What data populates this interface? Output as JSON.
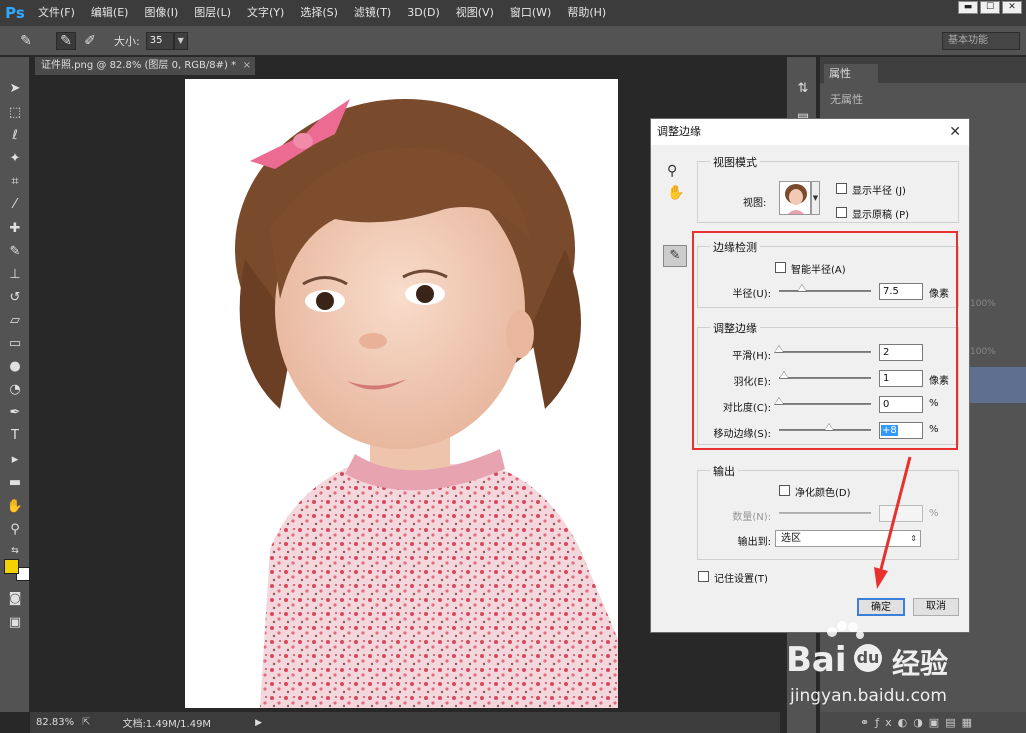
{
  "app": {
    "logo": "Ps",
    "menu": [
      "文件(F)",
      "编辑(E)",
      "图像(I)",
      "图层(L)",
      "文字(Y)",
      "选择(S)",
      "滤镜(T)",
      "3D(D)",
      "视图(V)",
      "窗口(W)",
      "帮助(H)"
    ],
    "window_controls": [
      "▬",
      "☐",
      "✕"
    ]
  },
  "options": {
    "size_label": "大小:",
    "size_value": "35",
    "workspace": "基本功能"
  },
  "document": {
    "tab_title": "证件照.png @ 82.8% (图层 0, RGB/8#) *",
    "tab_close": "×"
  },
  "statusbar": {
    "zoom": "82.83%",
    "doc_info": "文档:1.49M/1.49M"
  },
  "properties_panel": {
    "tab": "属性",
    "empty_text": "无属性"
  },
  "layers_panel": {
    "opacity_value": "100%",
    "fill_value": "100%"
  },
  "dialog": {
    "title": "调整边缘",
    "close": "✕",
    "view_mode": {
      "title": "视图模式",
      "view_label": "视图:",
      "show_radius": "显示半径 (J)",
      "show_original": "显示原稿 (P)"
    },
    "edge_detection": {
      "title": "边缘检测",
      "smart_radius": "智能半径(A)",
      "radius_label": "半径(U):",
      "radius_value": "7.5",
      "radius_unit": "像素",
      "radius_frac": 0.25
    },
    "adjust_edge": {
      "title": "调整边缘",
      "rows": [
        {
          "label": "平滑(H):",
          "value": "2",
          "unit": "",
          "frac": 0.0
        },
        {
          "label": "羽化(E):",
          "value": "1",
          "unit": "像素",
          "frac": 0.05
        },
        {
          "label": "对比度(C):",
          "value": "0",
          "unit": "%",
          "frac": 0.0
        },
        {
          "label": "移动边缘(S):",
          "value": "+8",
          "unit": "%",
          "frac": 0.54
        }
      ]
    },
    "output": {
      "title": "输出",
      "decontaminate": "净化颜色(D)",
      "amount_label": "数量(N):",
      "amount_unit": "%",
      "output_to_label": "输出到:",
      "output_to_value": "选区"
    },
    "remember": "记住设置(T)",
    "ok": "确定",
    "cancel": "取消"
  },
  "watermark": {
    "brand": "Bai",
    "brand2": "经验",
    "url": "jingyan.baidu.com"
  },
  "colors": {
    "accent_ps": "#31a8ff",
    "highlight_red": "#e8302f",
    "foreground": "#f5d300",
    "background": "#ffffff"
  }
}
